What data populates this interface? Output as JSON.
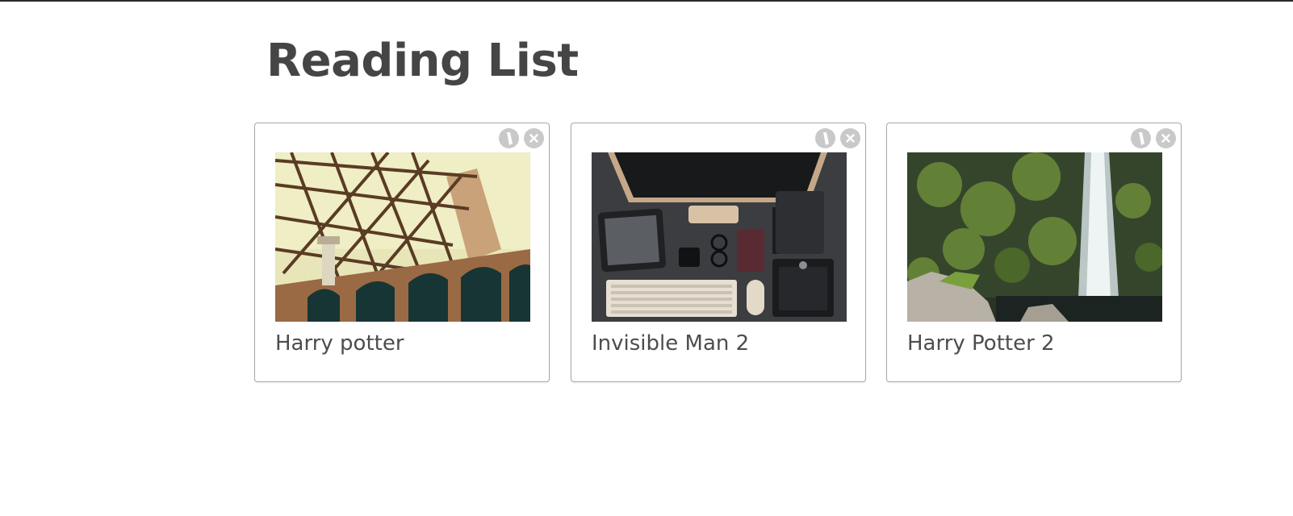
{
  "header": {
    "title": "Reading List"
  },
  "cards": [
    {
      "title": "Harry potter",
      "image_subject": "steel-bridge-arches-photo",
      "edit_icon": "pencil-icon",
      "delete_icon": "close-icon"
    },
    {
      "title": "Invisible Man 2",
      "image_subject": "desk-computer-flatlay-photo",
      "edit_icon": "pencil-icon",
      "delete_icon": "close-icon"
    },
    {
      "title": "Harry Potter 2",
      "image_subject": "waterfall-mossy-cliff-photo",
      "edit_icon": "pencil-icon",
      "delete_icon": "close-icon"
    }
  ],
  "colors": {
    "title_text": "#454545",
    "card_border": "#a8a8a8",
    "icon_bg": "#c9c9c9"
  }
}
